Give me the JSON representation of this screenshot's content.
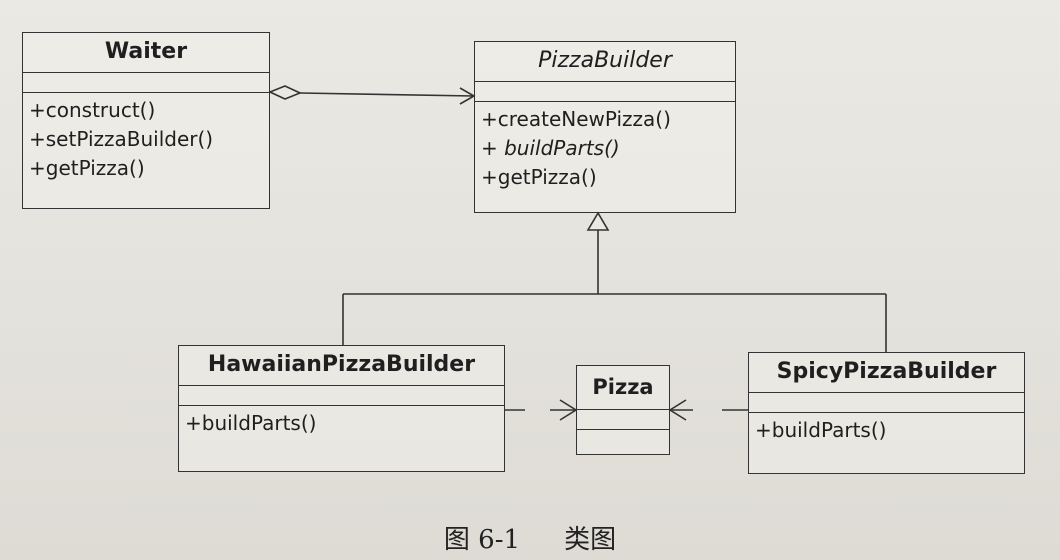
{
  "classes": {
    "waiter": {
      "name": "Waiter",
      "operations": [
        "+construct()",
        "+setPizzaBuilder()",
        "+getPizza()"
      ]
    },
    "pizza_builder": {
      "name": "PizzaBuilder",
      "operations": [
        "+createNewPizza()",
        "+ buildParts()",
        "+getPizza()"
      ]
    },
    "hawaiian": {
      "name": "HawaiianPizzaBuilder",
      "operations": [
        "+buildParts()"
      ]
    },
    "pizza": {
      "name": "Pizza"
    },
    "spicy": {
      "name": "SpicyPizzaBuilder",
      "operations": [
        "+buildParts()"
      ]
    }
  },
  "caption": {
    "number": "图 6-1",
    "title": "类图"
  }
}
